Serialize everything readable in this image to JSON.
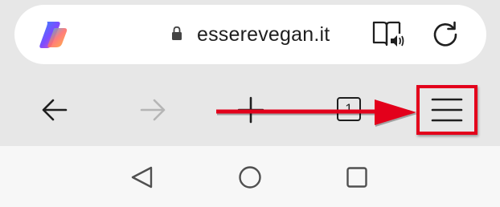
{
  "address_bar": {
    "url": "esserevegan.it",
    "leading_icon": "copilot-logo",
    "secure_icon": "lock-icon",
    "actions": [
      "reader-mode-icon",
      "reload-icon"
    ]
  },
  "toolbar": {
    "buttons": [
      "back-icon",
      "forward-icon",
      "new-tab-icon",
      "tabs-button",
      "menu-icon"
    ],
    "tab_count": "1",
    "forward_enabled": false
  },
  "annotation": {
    "type": "arrow-to-highlighted-menu",
    "color": "#e3001b"
  },
  "system_nav": {
    "buttons": [
      "nav-back-icon",
      "nav-home-icon",
      "nav-recents-icon"
    ]
  },
  "colors": {
    "background": "#e7e7e7",
    "address_bar": "#ffffff",
    "icon": "#1f1f1f",
    "disabled_icon": "#b5b5b5",
    "nav_bar": "#f7f7f7"
  }
}
